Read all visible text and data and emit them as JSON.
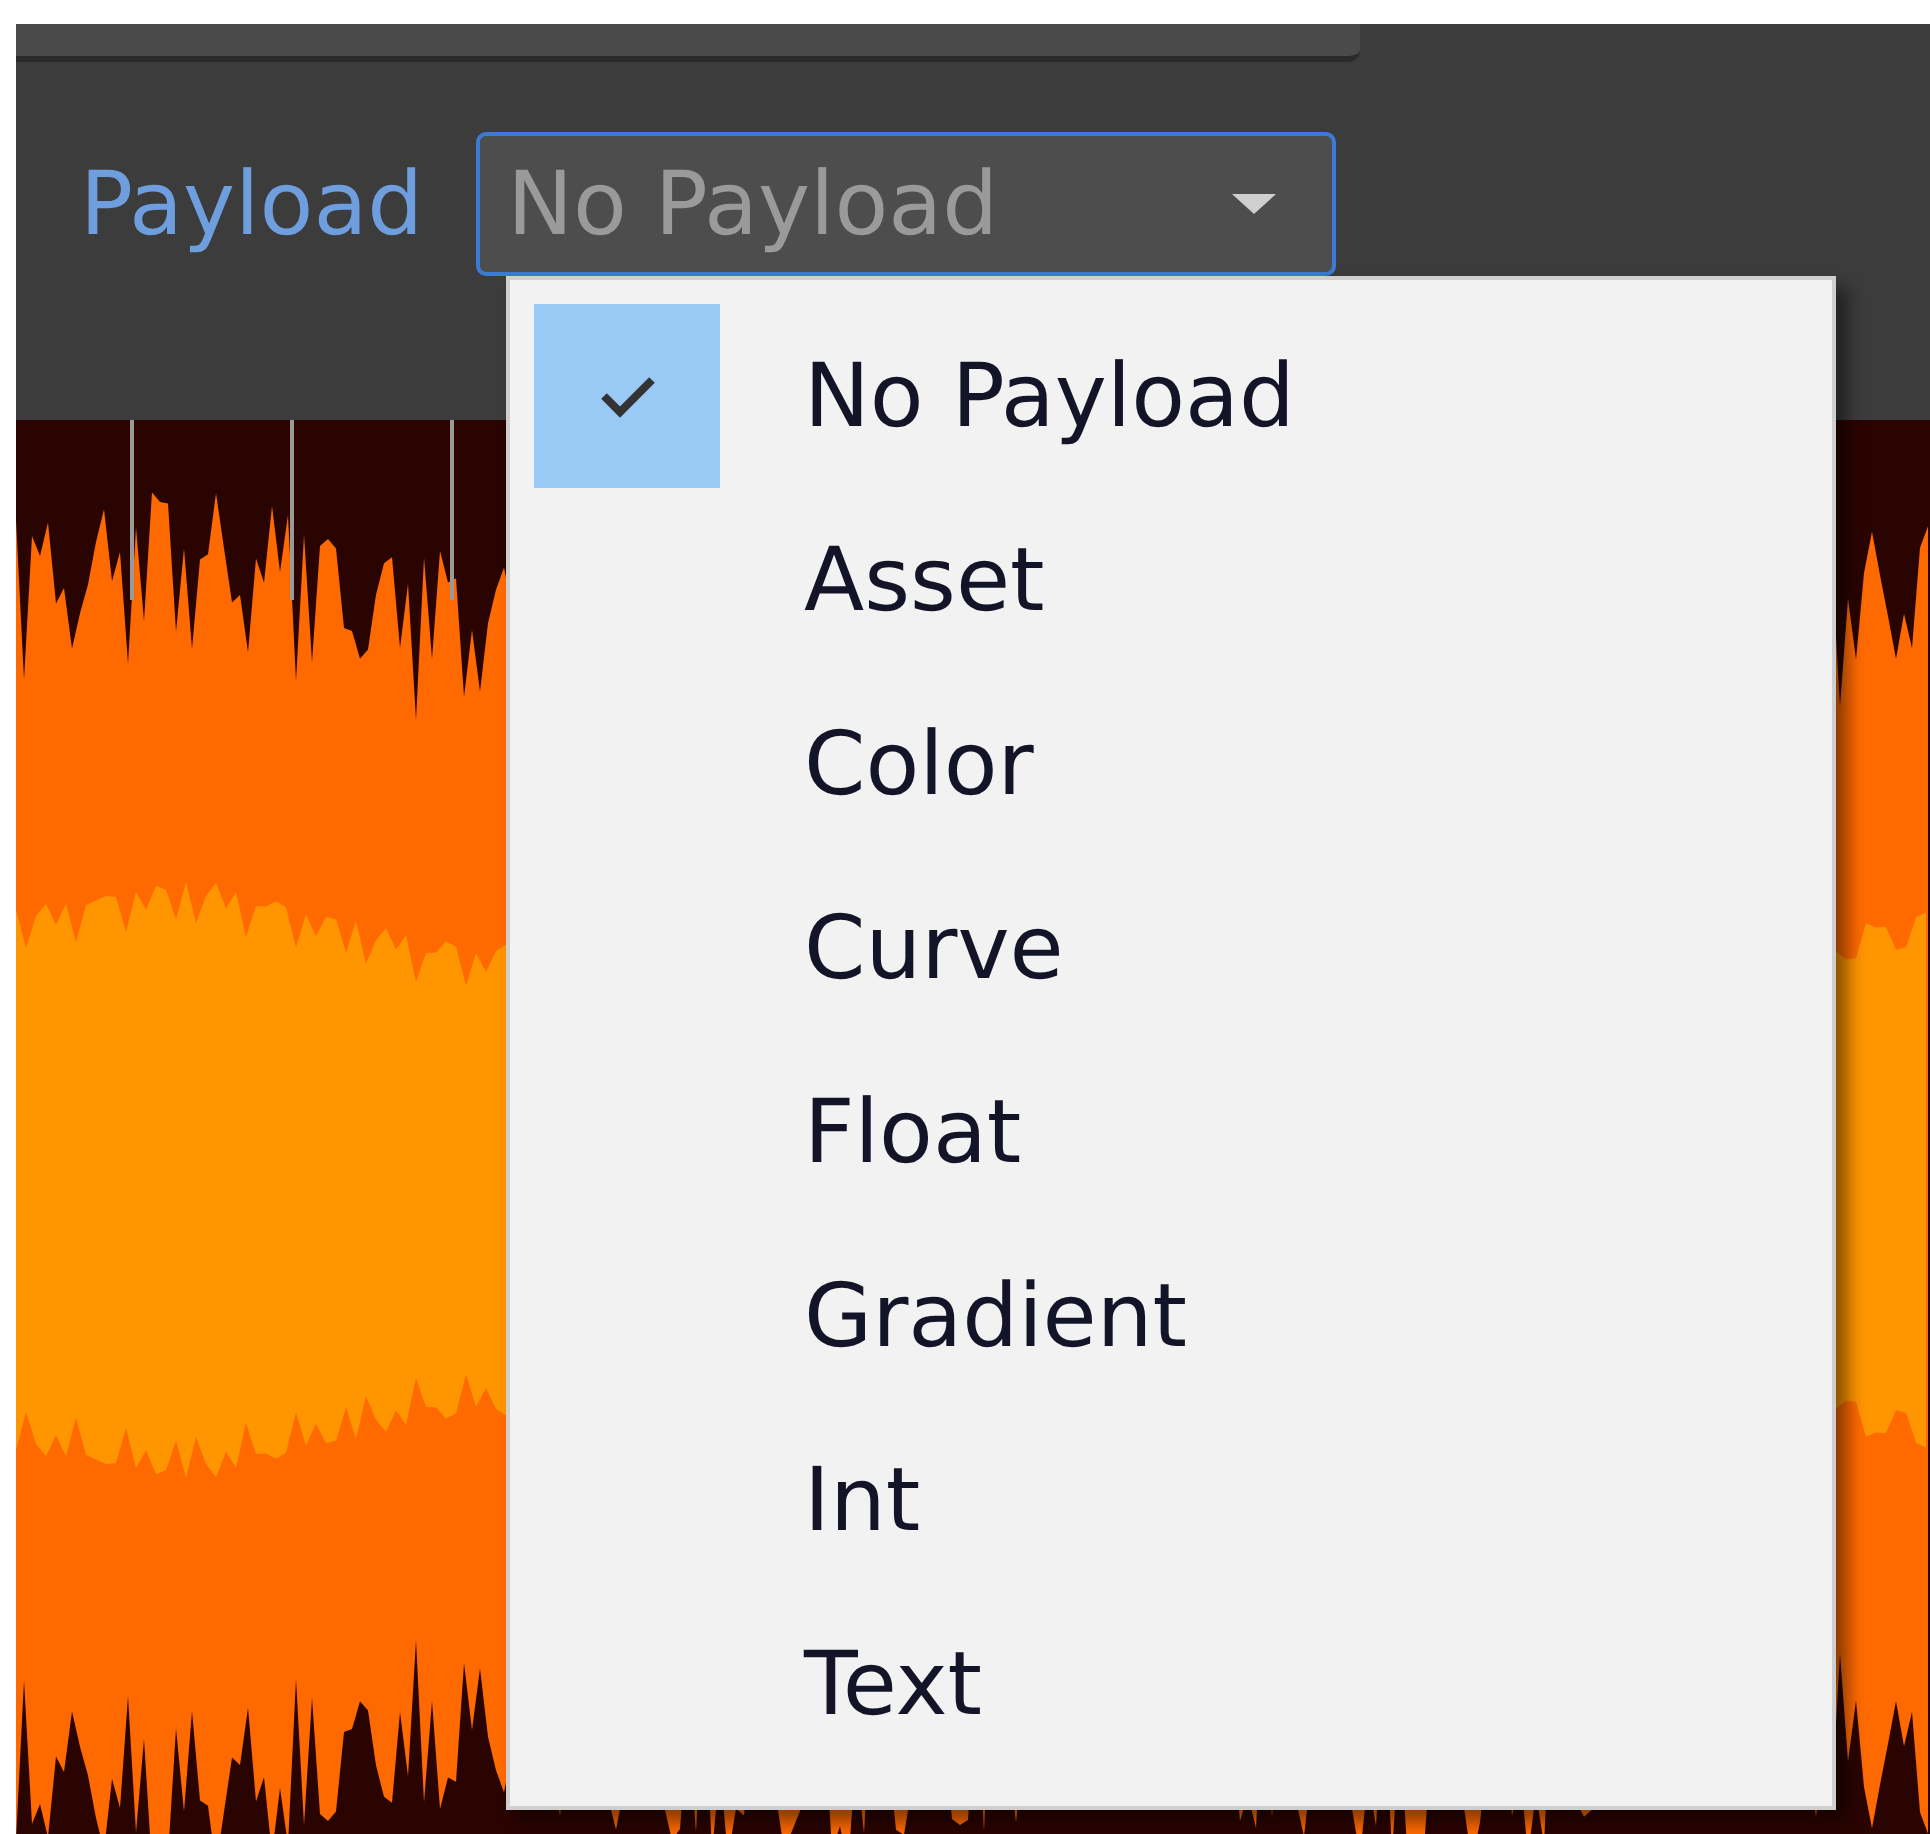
{
  "toolbar": {
    "label": "Payload",
    "dropdown": {
      "value": "No Payload",
      "expanded": true
    }
  },
  "menu": {
    "items": [
      {
        "label": "No Payload",
        "selected": true
      },
      {
        "label": "Asset",
        "selected": false
      },
      {
        "label": "Color",
        "selected": false
      },
      {
        "label": "Curve",
        "selected": false
      },
      {
        "label": "Float",
        "selected": false
      },
      {
        "label": "Gradient",
        "selected": false
      },
      {
        "label": "Int",
        "selected": false
      },
      {
        "label": "Text",
        "selected": false
      }
    ]
  }
}
